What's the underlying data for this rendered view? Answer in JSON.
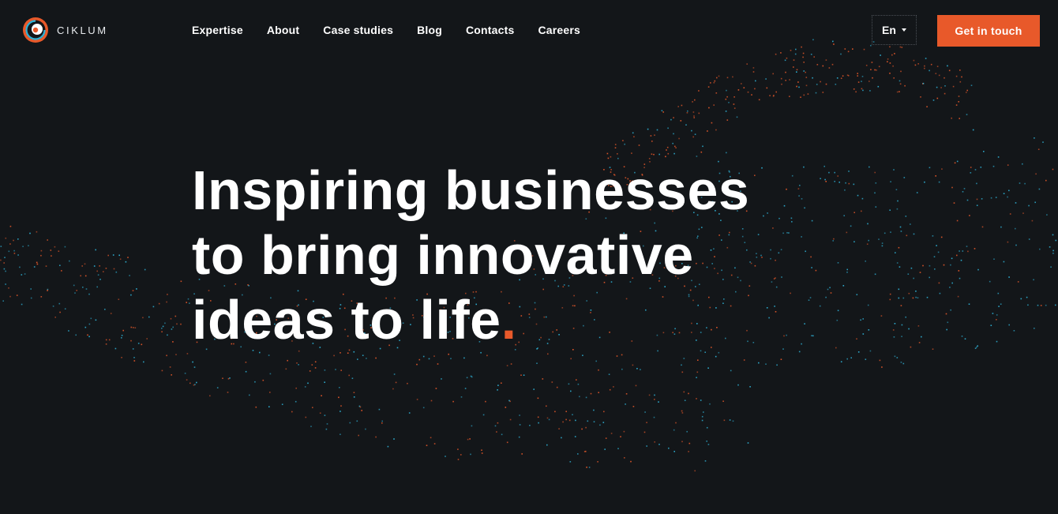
{
  "brand": {
    "name": "CIKLUM",
    "accent_color": "#e8592a",
    "secondary_color": "#2fb2d6",
    "background_color": "#131619"
  },
  "nav": {
    "items": [
      {
        "label": "Expertise"
      },
      {
        "label": "About"
      },
      {
        "label": "Case studies"
      },
      {
        "label": "Blog"
      },
      {
        "label": "Contacts"
      },
      {
        "label": "Careers"
      }
    ]
  },
  "language": {
    "selected": "En",
    "icon": "chevron-down-icon"
  },
  "cta": {
    "label": "Get in touch"
  },
  "hero": {
    "line1": "Inspiring businesses",
    "line2": "to bring innovative",
    "line3": "ideas to life",
    "accent_mark": "."
  },
  "background": {
    "decoration": "particle-wave-icon",
    "dot_colors": [
      "#e8592a",
      "#2fb2d6"
    ]
  }
}
